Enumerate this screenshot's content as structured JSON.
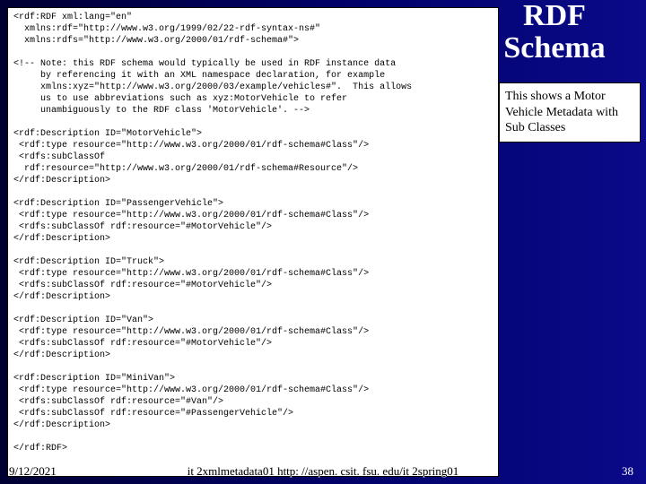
{
  "title_line1": "RDF",
  "title_line2": "Schema",
  "note": "This shows a Motor Vehicle Metadata with Sub Classes",
  "code": "<rdf:RDF xml:lang=\"en\"\n  xmlns:rdf=\"http://www.w3.org/1999/02/22-rdf-syntax-ns#\"\n  xmlns:rdfs=\"http://www.w3.org/2000/01/rdf-schema#\">\n\n<!-- Note: this RDF schema would typically be used in RDF instance data\n     by referencing it with an XML namespace declaration, for example\n     xmlns:xyz=\"http://www.w3.org/2000/03/example/vehicles#\".  This allows\n     us to use abbreviations such as xyz:MotorVehicle to refer\n     unambiguously to the RDF class 'MotorVehicle'. -->\n\n<rdf:Description ID=\"MotorVehicle\">\n <rdf:type resource=\"http://www.w3.org/2000/01/rdf-schema#Class\"/>\n <rdfs:subClassOf\n  rdf:resource=\"http://www.w3.org/2000/01/rdf-schema#Resource\"/>\n</rdf:Description>\n\n<rdf:Description ID=\"PassengerVehicle\">\n <rdf:type resource=\"http://www.w3.org/2000/01/rdf-schema#Class\"/>\n <rdfs:subClassOf rdf:resource=\"#MotorVehicle\"/>\n</rdf:Description>\n\n<rdf:Description ID=\"Truck\">\n <rdf:type resource=\"http://www.w3.org/2000/01/rdf-schema#Class\"/>\n <rdfs:subClassOf rdf:resource=\"#MotorVehicle\"/>\n</rdf:Description>\n\n<rdf:Description ID=\"Van\">\n <rdf:type resource=\"http://www.w3.org/2000/01/rdf-schema#Class\"/>\n <rdfs:subClassOf rdf:resource=\"#MotorVehicle\"/>\n</rdf:Description>\n\n<rdf:Description ID=\"MiniVan\">\n <rdf:type resource=\"http://www.w3.org/2000/01/rdf-schema#Class\"/>\n <rdfs:subClassOf rdf:resource=\"#Van\"/>\n <rdfs:subClassOf rdf:resource=\"#PassengerVehicle\"/>\n</rdf:Description>\n\n</rdf:RDF>",
  "footer": {
    "date": "9/12/2021",
    "center": "it 2xmlmetadata01  http: //aspen. csit. fsu. edu/it 2spring01",
    "pagenum": "38"
  }
}
